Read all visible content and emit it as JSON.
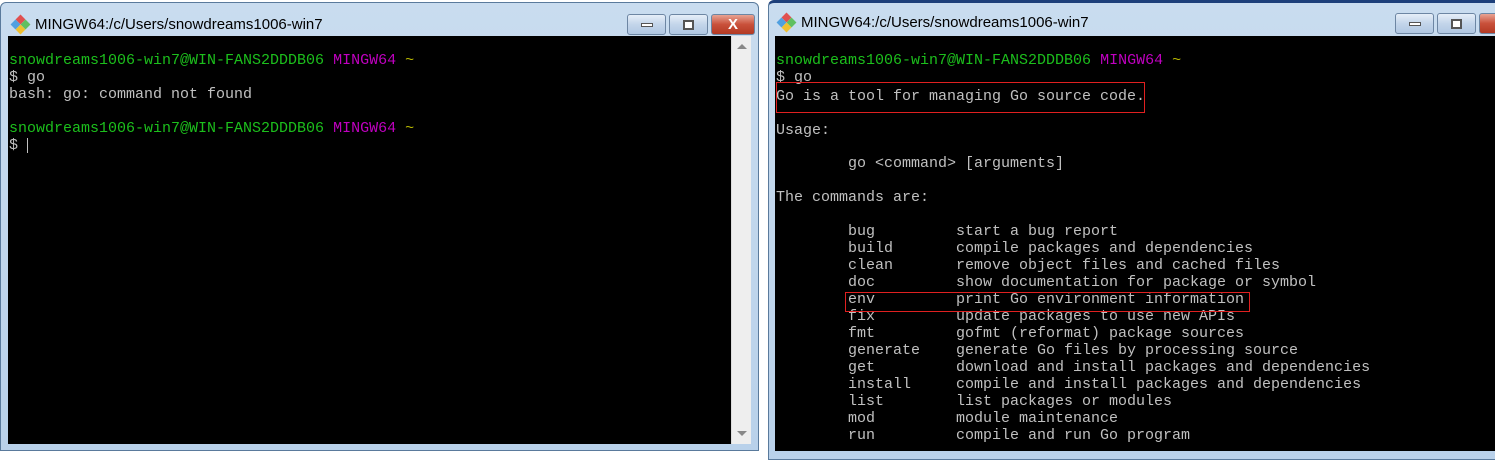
{
  "left_window": {
    "title": "MINGW64:/c/Users/snowdreams1006-win7",
    "lines": [
      {
        "user": "snowdreams1006-win7@WIN-FANS2DDDB06",
        "env": "MINGW64",
        "dir": "~"
      },
      {
        "text": "$ go"
      },
      {
        "text": "bash: go: command not found"
      },
      {
        "user": "snowdreams1006-win7@WIN-FANS2DDDB06",
        "env": "MINGW64",
        "dir": "~"
      },
      {
        "text": "$ "
      }
    ]
  },
  "right_window": {
    "title": "MINGW64:/c/Users/snowdreams1006-win7",
    "prompt": {
      "user": "snowdreams1006-win7@WIN-FANS2DDDB06",
      "env": "MINGW64",
      "dir": "~"
    },
    "command": "$ go",
    "intro": "Go is a tool for managing Go source code.",
    "usage_label": "Usage:",
    "usage": "go <command> [arguments]",
    "commands_label": "The commands are:",
    "commands": [
      {
        "name": "bug",
        "desc": "start a bug report"
      },
      {
        "name": "build",
        "desc": "compile packages and dependencies"
      },
      {
        "name": "clean",
        "desc": "remove object files and cached files"
      },
      {
        "name": "doc",
        "desc": "show documentation for package or symbol"
      },
      {
        "name": "env",
        "desc": "print Go environment information"
      },
      {
        "name": "fix",
        "desc": "update packages to use new APIs"
      },
      {
        "name": "fmt",
        "desc": "gofmt (reformat) package sources"
      },
      {
        "name": "generate",
        "desc": "generate Go files by processing source"
      },
      {
        "name": "get",
        "desc": "download and install packages and dependencies"
      },
      {
        "name": "install",
        "desc": "compile and install packages and dependencies"
      },
      {
        "name": "list",
        "desc": "list packages or modules"
      },
      {
        "name": "mod",
        "desc": "module maintenance"
      },
      {
        "name": "run",
        "desc": "compile and run Go program"
      }
    ]
  },
  "window_buttons": {
    "close": "X"
  }
}
